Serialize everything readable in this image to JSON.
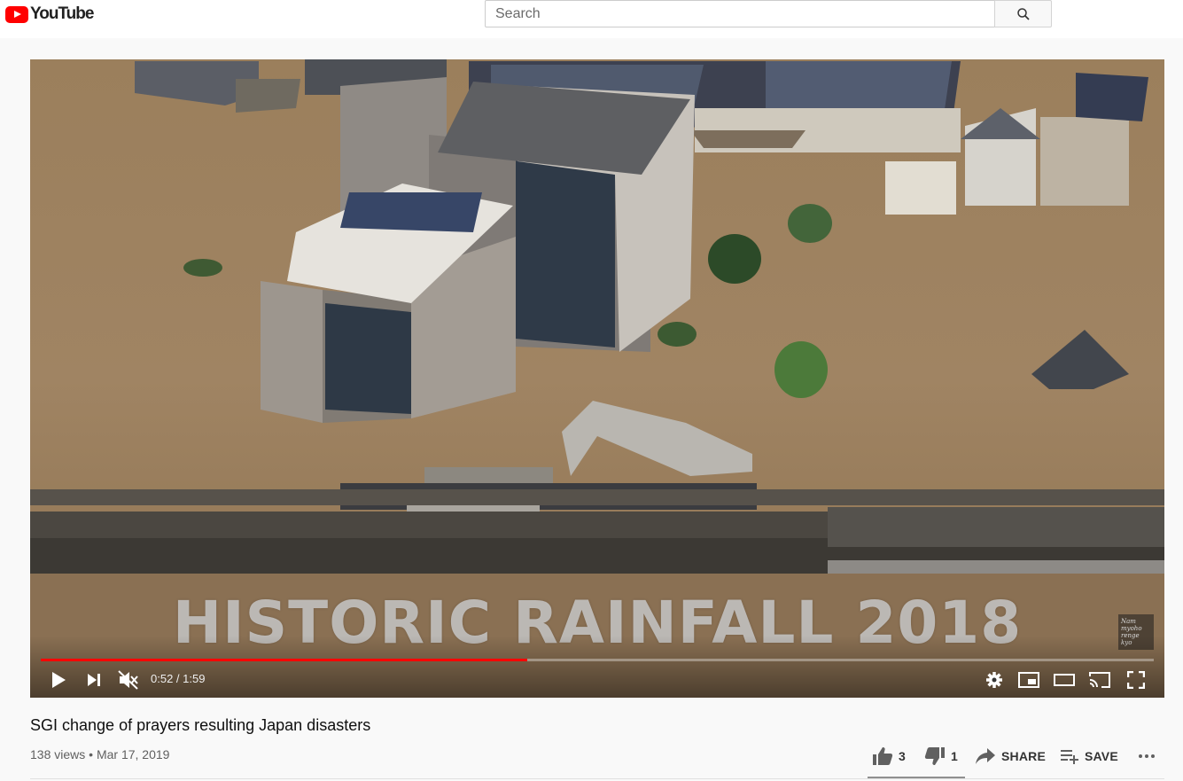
{
  "header": {
    "logo_text": "YouTube",
    "search_placeholder": "Search"
  },
  "player": {
    "overlay_title": "HISTORIC RAINFALL 2018",
    "watermark_text": "Nam myoho renge kyo",
    "time_current": "0:52",
    "time_separator": " / ",
    "time_total": "1:59",
    "progress_fraction": 0.437,
    "progress_color": "#ff0000"
  },
  "video": {
    "title": "SGI change of prayers resulting Japan disasters",
    "views": "138 views",
    "meta_separator": " • ",
    "date": "Mar 17, 2019"
  },
  "actions": {
    "like_count": "3",
    "dislike_count": "1",
    "share_label": "SHARE",
    "save_label": "SAVE"
  },
  "icons": [
    "youtube-logo-icon",
    "search-icon",
    "play-icon",
    "next-icon",
    "mute-icon",
    "settings-icon",
    "miniplayer-icon",
    "theater-icon",
    "cast-icon",
    "fullscreen-icon",
    "thumb-up-icon",
    "thumb-down-icon",
    "share-icon",
    "playlist-add-icon",
    "more-icon"
  ]
}
